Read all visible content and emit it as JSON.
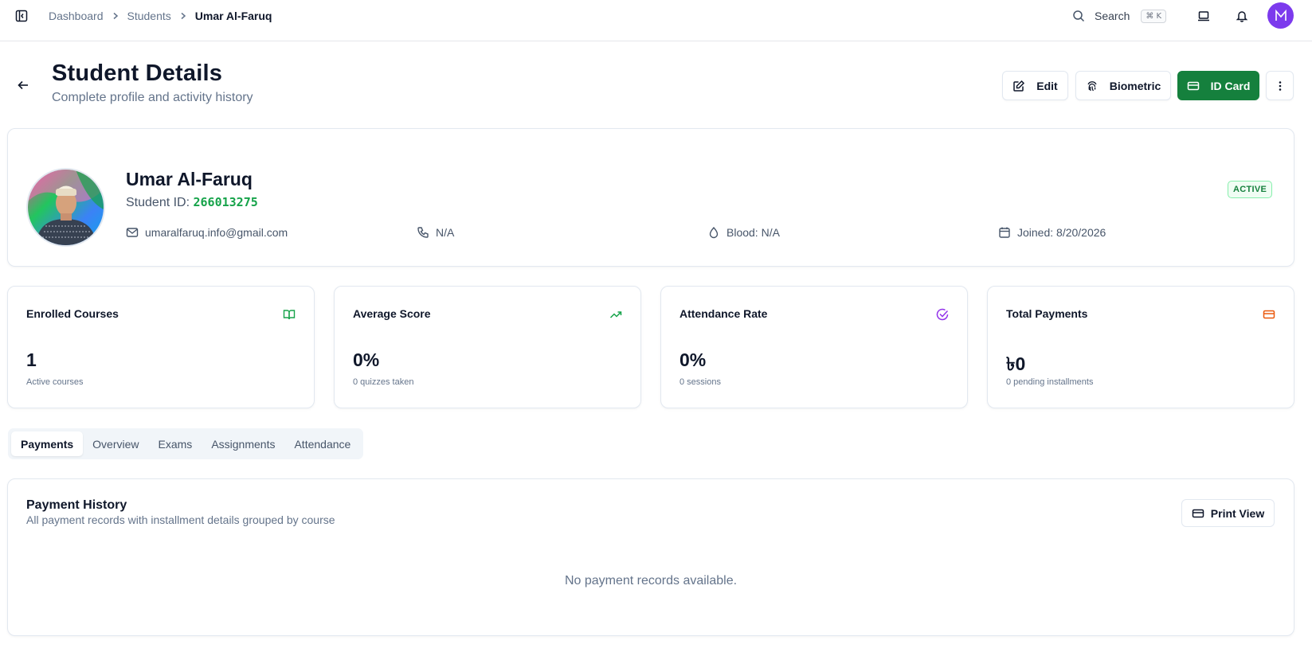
{
  "breadcrumb": {
    "items": [
      "Dashboard",
      "Students"
    ],
    "current": "Umar Al-Faruq"
  },
  "search": {
    "label": "Search",
    "shortcut": "⌘ K"
  },
  "header": {
    "title": "Student Details",
    "subtitle": "Complete profile and activity history",
    "edit_label": "Edit",
    "biometric_label": "Biometric",
    "id_card_label": "ID Card"
  },
  "profile": {
    "name": "Umar Al-Faruq",
    "id_label": "Student ID:",
    "id_value": "266013275",
    "status": "ACTIVE",
    "email": "umaralfaruq.info@gmail.com",
    "phone": "N/A",
    "blood": "Blood: N/A",
    "joined": "Joined: 8/20/2026"
  },
  "stats": [
    {
      "title": "Enrolled Courses",
      "value": "1",
      "sub": "Active courses",
      "icon": "book-open-icon",
      "color": "#16a34a"
    },
    {
      "title": "Average Score",
      "value": "0%",
      "sub": "0 quizzes taken",
      "icon": "trending-up-icon",
      "color": "#16a34a"
    },
    {
      "title": "Attendance Rate",
      "value": "0%",
      "sub": "0 sessions",
      "icon": "circle-check-icon",
      "color": "#9333ea"
    },
    {
      "title": "Total Payments",
      "value": "৳0",
      "sub": "0 pending installments",
      "icon": "credit-card-icon",
      "color": "#ea580c"
    }
  ],
  "tabs": [
    "Payments",
    "Overview",
    "Exams",
    "Assignments",
    "Attendance"
  ],
  "payments": {
    "title": "Payment History",
    "subtitle": "All payment records with installment details grouped by course",
    "print_label": "Print View",
    "empty": "No payment records available."
  },
  "colors": {
    "primary": "#15803d",
    "avatar_bg": "#7c3aed",
    "status": "#15803d"
  }
}
